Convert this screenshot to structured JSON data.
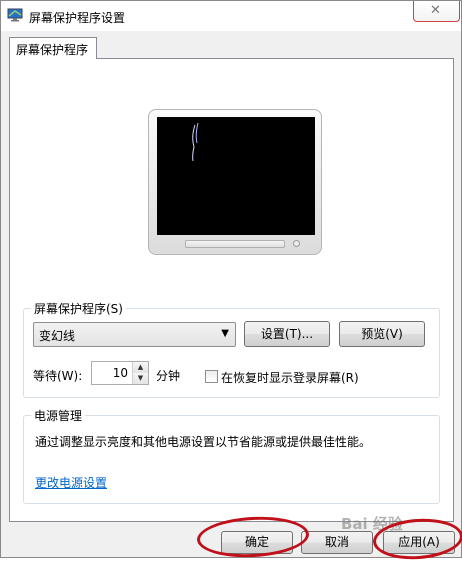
{
  "window": {
    "title": "屏幕保护程序设置",
    "close_glyph": "✕"
  },
  "tab": {
    "label": "屏幕保护程序"
  },
  "screensaver": {
    "group_label": "屏幕保护程序(S)",
    "selected": "变幻线",
    "settings_label": "设置(T)...",
    "preview_label": "预览(V)",
    "wait_label": "等待(W):",
    "wait_value": "10",
    "minutes_label": "分钟",
    "resume_label": "在恢复时显示登录屏幕(R)",
    "resume_checked": false
  },
  "power": {
    "group_label": "电源管理",
    "description": "通过调整显示亮度和其他电源设置以节省能源或提供最佳性能。",
    "link_label": "更改电源设置"
  },
  "buttons": {
    "ok": "确定",
    "cancel": "取消",
    "apply": "应用(A)"
  },
  "watermark": "Bai 经验",
  "colors": {
    "annotation": "#c0101a",
    "link": "#0066cc"
  }
}
